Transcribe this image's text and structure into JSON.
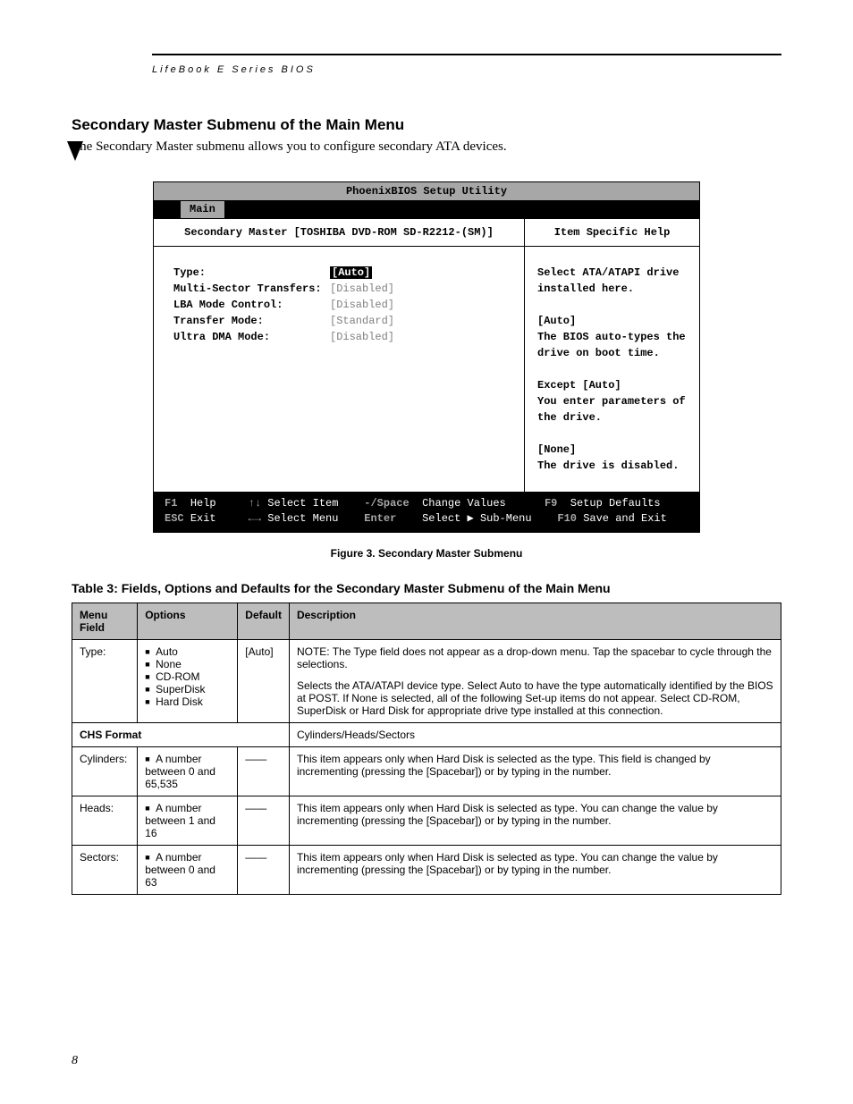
{
  "running_head": "LifeBook E Series BIOS",
  "section_title": "Secondary Master Submenu of the Main Menu",
  "intro": "The Secondary Master submenu allows you to configure secondary ATA devices.",
  "bios": {
    "title": "PhoenixBIOS Setup Utility",
    "menu_tab": "Main",
    "left_header": "Secondary Master [TOSHIBA DVD-ROM SD-R2212-(SM)]",
    "right_header": "Item Specific Help",
    "fields": [
      {
        "label": "Type:",
        "value": "[Auto]",
        "selected": true
      },
      {
        "label": "",
        "value": "",
        "selected": false
      },
      {
        "label": "Multi-Sector Transfers:",
        "value": "[Disabled]",
        "selected": false
      },
      {
        "label": "LBA Mode Control:",
        "value": "[Disabled]",
        "selected": false
      },
      {
        "label": "Transfer Mode:",
        "value": "[Standard]",
        "selected": false
      },
      {
        "label": "Ultra DMA Mode:",
        "value": "[Disabled]",
        "selected": false
      }
    ],
    "help_lines": [
      "Select ATA/ATAPI drive",
      "installed here.",
      "",
      "[Auto]",
      "The BIOS auto-types the",
      "drive on boot time.",
      "",
      "Except [Auto]",
      "You enter parameters of",
      "the drive.",
      "",
      "[None]",
      "The drive is disabled."
    ],
    "footer": {
      "l1": {
        "k1": "F1",
        "t1": "Help",
        "k2": "↑↓",
        "t2": "Select Item",
        "k3": "-/Space",
        "t3": "Change Values",
        "k4": "F9",
        "t4": "Setup Defaults"
      },
      "l2": {
        "k1": "ESC",
        "t1": "Exit",
        "k2": "←→",
        "t2": "Select Menu",
        "k3": "Enter",
        "t3": "Select ▶ Sub-Menu",
        "k4": "F10",
        "t4": "Save and Exit"
      }
    }
  },
  "figure_caption": "Figure 3.  Secondary Master Submenu",
  "table_title": "Table 3: Fields, Options and Defaults for the Secondary Master Submenu of the Main Menu",
  "table": {
    "headers": [
      "Menu Field",
      "Options",
      "Default",
      "Description"
    ],
    "rows": [
      {
        "field": "Type:",
        "options": [
          "Auto",
          "None",
          "CD-ROM",
          "SuperDisk",
          "Hard Disk"
        ],
        "default": "[Auto]",
        "description": "NOTE: The Type field does not appear as a drop-down menu. Tap the spacebar to cycle through the selections.\n\nSelects the ATA/ATAPI device type. Select Auto to have the type automatically identified by the BIOS at POST. If None is selected, all of the following Set-up items do not appear. Select CD-ROM, SuperDisk or Hard Disk for appropriate drive type installed at this connection."
      },
      {
        "section": "CHS Format",
        "section_desc": "Cylinders/Heads/Sectors"
      },
      {
        "field": "Cylinders:",
        "options": [
          "A number between 0 and 65,535"
        ],
        "default": "——",
        "description": "This item appears only when Hard Disk is selected as the type. This field is changed by incrementing (pressing the [Spacebar]) or by typing in the number."
      },
      {
        "field": "Heads:",
        "options": [
          "A number between 1 and 16"
        ],
        "default": "——",
        "description": "This item appears only when Hard Disk is selected as type. You can change the value by incrementing (pressing the [Spacebar]) or by typing in the number."
      },
      {
        "field": "Sectors:",
        "options": [
          "A number between 0 and 63"
        ],
        "default": "——",
        "description": "This item appears only when Hard Disk is selected as type. You can change the value by incrementing (pressing the [Spacebar]) or by typing in the number."
      }
    ]
  },
  "page_number": "8"
}
